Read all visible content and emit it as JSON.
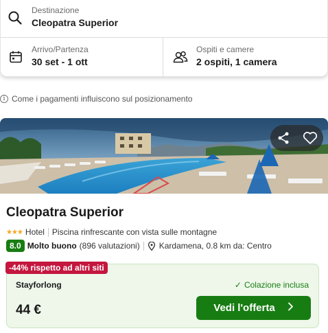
{
  "search": {
    "destination_label": "Destinazione",
    "destination_value": "Cleopatra Superior",
    "dates_label": "Arrivo/Partenza",
    "dates_value": "30 set - 1 ott",
    "guests_label": "Ospiti e camere",
    "guests_value": "2 ospiti, 1 camera"
  },
  "info_note": "Come i pagamenti influiscono sul posizionamento",
  "hotel": {
    "name": "Cleopatra Superior",
    "stars": "★★★",
    "type": "Hotel",
    "highlight": "Piscina rinfrescante con vista sulle montagne",
    "score": "8.0",
    "rating_word": "Molto buono",
    "reviews": "(896 valutazioni)",
    "location": "Kardamena, 0.8 km da: Centro"
  },
  "offer": {
    "discount_badge": "-44% rispetto ad altri siti",
    "provider": "Stayforlong",
    "breakfast": "Colazione inclusa",
    "price": "44 €",
    "cta_label": "Vedi l'offerta"
  },
  "colors": {
    "brand_green": "#177d12",
    "discount_red": "#c4163e",
    "star_gold": "#f5a623"
  },
  "icons": [
    "search-icon",
    "calendar-icon",
    "people-icon",
    "info-icon",
    "share-icon",
    "heart-icon",
    "location-pin-icon",
    "check-icon",
    "chevron-right-icon"
  ]
}
